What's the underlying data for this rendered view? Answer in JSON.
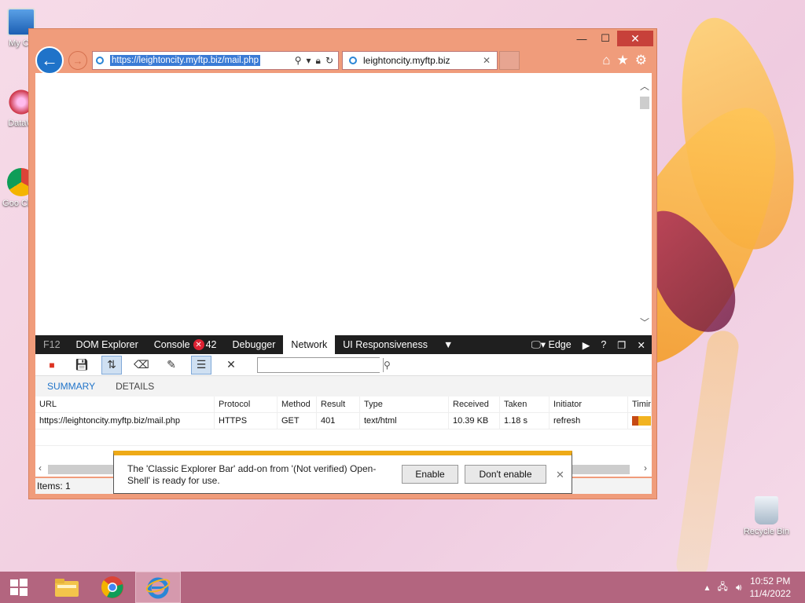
{
  "desktop": {
    "icons": [
      {
        "label": "My Co"
      },
      {
        "label": "DataW"
      },
      {
        "label": "Goo Chro"
      },
      {
        "label": "Recycle Bin"
      }
    ]
  },
  "browser": {
    "address_url": "https://leightoncity.myftp.biz/mail.php",
    "tab_title": "leightoncity.myftp.biz",
    "window_buttons": {
      "minimize": "—",
      "maximize": "☐",
      "close": "✕"
    }
  },
  "devtools": {
    "tabs": {
      "f12": "F12",
      "dom": "DOM Explorer",
      "console": "Console",
      "console_errors": "42",
      "debugger": "Debugger",
      "network": "Network",
      "ui": "UI Responsiveness",
      "mode": "Edge"
    },
    "subtabs": {
      "summary": "SUMMARY",
      "details": "DETAILS"
    },
    "search_value": "",
    "columns": [
      "URL",
      "Protocol",
      "Method",
      "Result",
      "Type",
      "Received",
      "Taken",
      "Initiator",
      "Timin"
    ],
    "rows": [
      {
        "url": "https://leightoncity.myftp.biz/mail.php",
        "protocol": "HTTPS",
        "method": "GET",
        "result": "401",
        "type": "text/html",
        "received": "10.39 KB",
        "taken": "1.18 s",
        "initiator": "refresh"
      }
    ],
    "items_text": "Items: 1"
  },
  "notification": {
    "message": "The 'Classic Explorer Bar' add-on from '(Not verified) Open-Shell' is ready for use.",
    "enable_label": "Enable",
    "dont_enable_label": "Don't enable"
  },
  "taskbar": {
    "time": "10:52 PM",
    "date": "11/4/2022"
  },
  "colors": {
    "ie_blue": "#1f73c9",
    "window_frame": "#f09c7b",
    "notify_accent": "#eeaa17",
    "taskbar": "#b3657f"
  }
}
